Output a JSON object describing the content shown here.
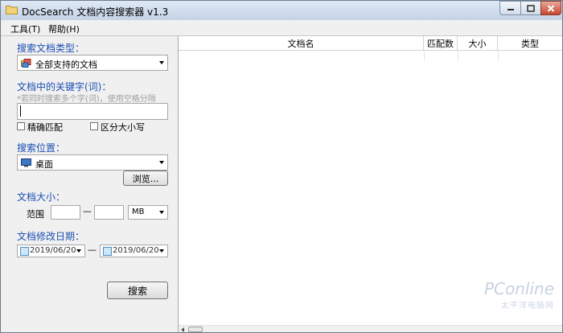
{
  "window": {
    "title": "DocSearch 文档内容搜索器 v1.3"
  },
  "menu": {
    "tools": "工具(T)",
    "help": "帮助(H)"
  },
  "search_type": {
    "title": "搜索文档类型：",
    "selected": "全部支持的文档"
  },
  "keyword": {
    "title": "文档中的关键字(词)：",
    "hint": "*若同时搜索多个字(词)，使用空格分隔",
    "value": ""
  },
  "options": {
    "exact_match": "精确匹配",
    "case_sensitive": "区分大小写"
  },
  "location": {
    "title": "搜索位置：",
    "selected": "桌面",
    "browse_label": "浏览..."
  },
  "size": {
    "title": "文档大小：",
    "range_label": "范围",
    "min": "",
    "max": "",
    "dash": "—",
    "unit": "MB"
  },
  "date": {
    "title": "文档修改日期：",
    "from": "2019/06/20",
    "to": "2019/06/20",
    "dash": "—"
  },
  "search_button": "搜索",
  "table": {
    "columns": [
      "文档名",
      "匹配数",
      "大小",
      "类型"
    ]
  },
  "watermark": {
    "brand": "PConline",
    "sub": "太平洋电脑网"
  }
}
